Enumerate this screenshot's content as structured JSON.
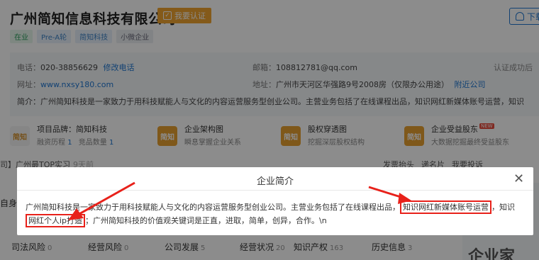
{
  "company": {
    "name": "广州简知信息科技有限公司",
    "claim_label": "我要认证",
    "download_label": "下载"
  },
  "tags": [
    "在业",
    "Pre-A轮",
    "简知科技",
    "小微企业"
  ],
  "contact": {
    "phone_label": "电话：",
    "phone": "020-38856629",
    "edit_phone": "修改电话",
    "email_label": "邮箱：",
    "email": "108812781@qq.com",
    "site_label": "网址：",
    "site": "www.nxsy180.com",
    "address_label": "地址：",
    "address": "广州市天河区华强路9号2008房（仅限办公用途）",
    "nearby": "附近公司",
    "cert_hint": "认证成功后",
    "intro": "简介：广州简知科技是一家致力于用科技赋能人与文化的内容运营服务型创业公司。主营业务包括了在线课程出品，知识网红新媒体账号运营，知识"
  },
  "cards": [
    {
      "logo": "简知",
      "l1": "项目品牌：简知科技",
      "l2_a": "融资历程",
      "l2_a_val": "1",
      "l2_b": "竞品数量",
      "l2_b_val": "1"
    },
    {
      "logo": "简知",
      "l1": "企业架构图",
      "l2": "瞬息掌握企业关系"
    },
    {
      "logo": "简知",
      "l1": "股权穿透图",
      "l2": "挖掘深层股权结构"
    },
    {
      "logo": "简知",
      "l1": "企业受益股东",
      "badge": "NEW",
      "l2": "大数据挖掘最终受益股东"
    }
  ],
  "news": {
    "left": "司】广州最TOP实习",
    "time": "9天前",
    "actions": [
      "发票抬头",
      "递名片",
      "我要投诉"
    ]
  },
  "side_text": "自身",
  "bottom_tabs": [
    {
      "label": "司法风险",
      "count": "0"
    },
    {
      "label": "经营风险",
      "count": "0"
    },
    {
      "label": "公司发展",
      "count": "5"
    },
    {
      "label": "经营状况",
      "count": "20"
    },
    {
      "label": "知识产权",
      "count": "163"
    },
    {
      "label": "历史信息",
      "count": "3"
    }
  ],
  "right_panel_text": "企业家",
  "modal": {
    "title": "企业简介",
    "line1_a": "广州简知科技是一家致力于用科技赋能人与文化的内容运营服务型创业公司。主营业务包括了在线课程出品，",
    "line1_hl": "知识网红新媒体账号运营",
    "line1_b": "，知识",
    "line2_hl": "网红个人ip打造",
    "line2_b": "；广州简知科技的价值观关键词是正直，进取，简单，创异，合作。\\n"
  },
  "colors": {
    "accent": "#1f77d1",
    "claim": "#f0a531",
    "highlight": "#e8211a",
    "overlay": "rgba(0,0,0,0.45)"
  }
}
